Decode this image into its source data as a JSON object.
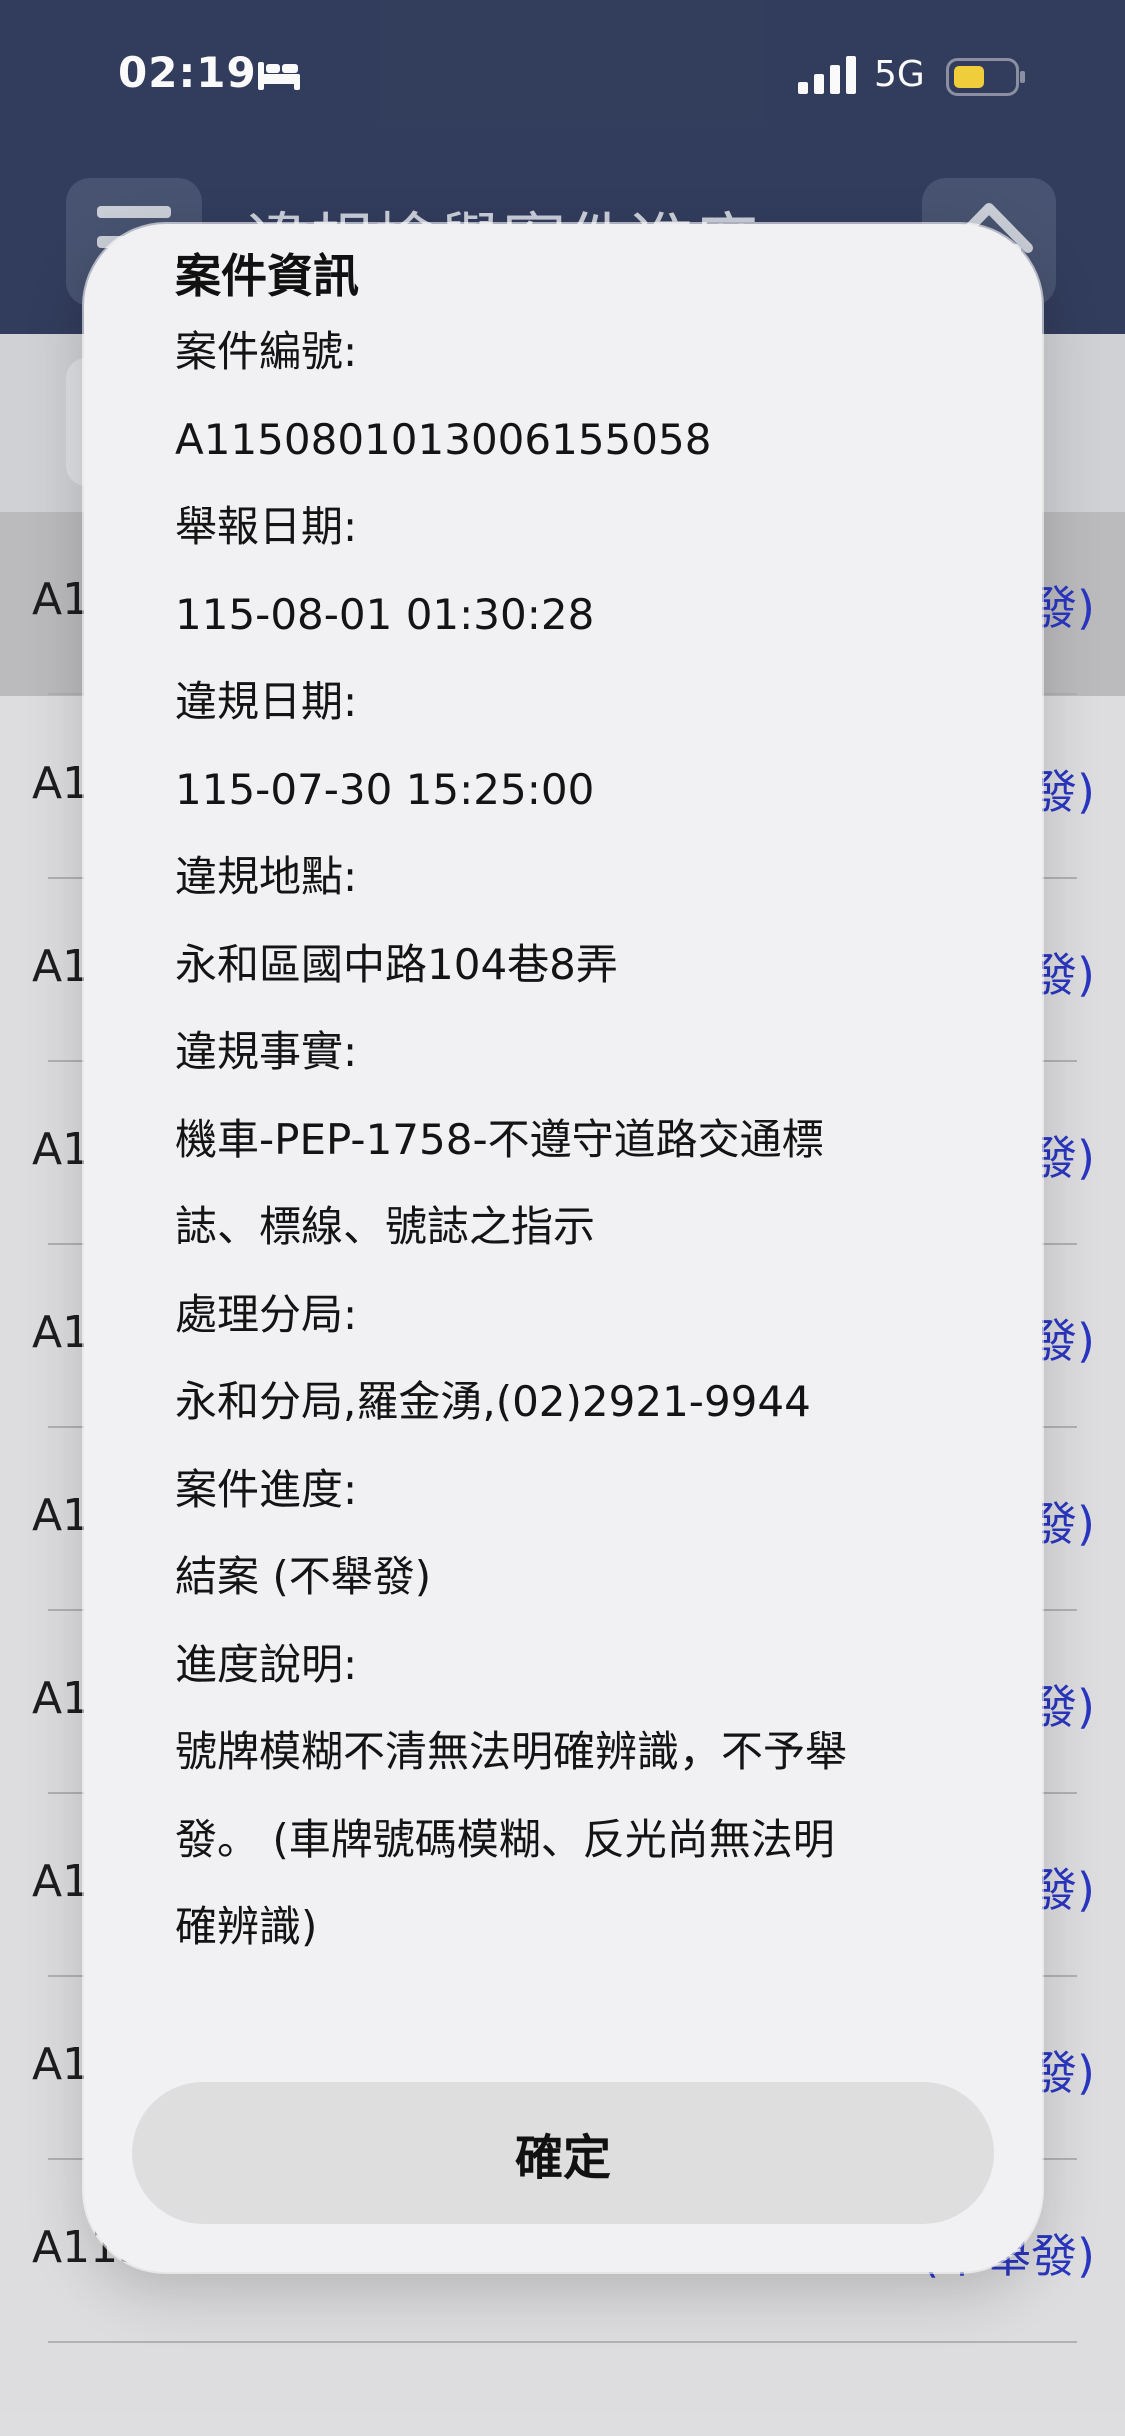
{
  "status_bar": {
    "time": "02:19",
    "network": "5G",
    "icons": [
      "bed-icon",
      "signal-icon",
      "battery-icon"
    ],
    "battery_color": "#f5d33d"
  },
  "header": {
    "title": "違規檢舉案件進度",
    "menu_icon": "menu-icon",
    "home_icon": "home-icon",
    "bar_color": "#343e5e"
  },
  "list": {
    "rows": [
      {
        "id": "A1",
        "status": "發)"
      },
      {
        "id": "A1",
        "status": "發)"
      },
      {
        "id": "A1",
        "status": "發)"
      },
      {
        "id": "A1",
        "status": "發)"
      },
      {
        "id": "A1",
        "status": "發)"
      },
      {
        "id": "A1",
        "status": "發)"
      },
      {
        "id": "A1",
        "status": "發)"
      },
      {
        "id": "A1",
        "status": "發)"
      },
      {
        "id": "A1",
        "status": "發)"
      },
      {
        "id": "A115",
        "status": "(不舉發)"
      }
    ],
    "status_color": "#2b38c4"
  },
  "dialog": {
    "title": "案件資訊",
    "fields": [
      {
        "label": "案件編號:",
        "value": "A1150801013006155058"
      },
      {
        "label": "舉報日期:",
        "value": "115-08-01 01:30:28"
      },
      {
        "label": "違規日期:",
        "value": "115-07-30 15:25:00"
      },
      {
        "label": "違規地點:",
        "value": "永和區國中路104巷8弄"
      },
      {
        "label": "違規事實:",
        "value": "機車-PEP-1758-不遵守道路交通標\n誌、標線、號誌之指示"
      },
      {
        "label": "處理分局:",
        "value": "永和分局,羅金湧,(02)2921-9944"
      },
      {
        "label": "案件進度:",
        "value": "結案 (不舉發)"
      },
      {
        "label": "進度說明:",
        "value": "號牌模糊不清無法明確辨識，不予舉\n發。 (車牌號碼模糊、反光尚無法明\n確辨識)"
      }
    ],
    "confirm_label": "確定"
  }
}
